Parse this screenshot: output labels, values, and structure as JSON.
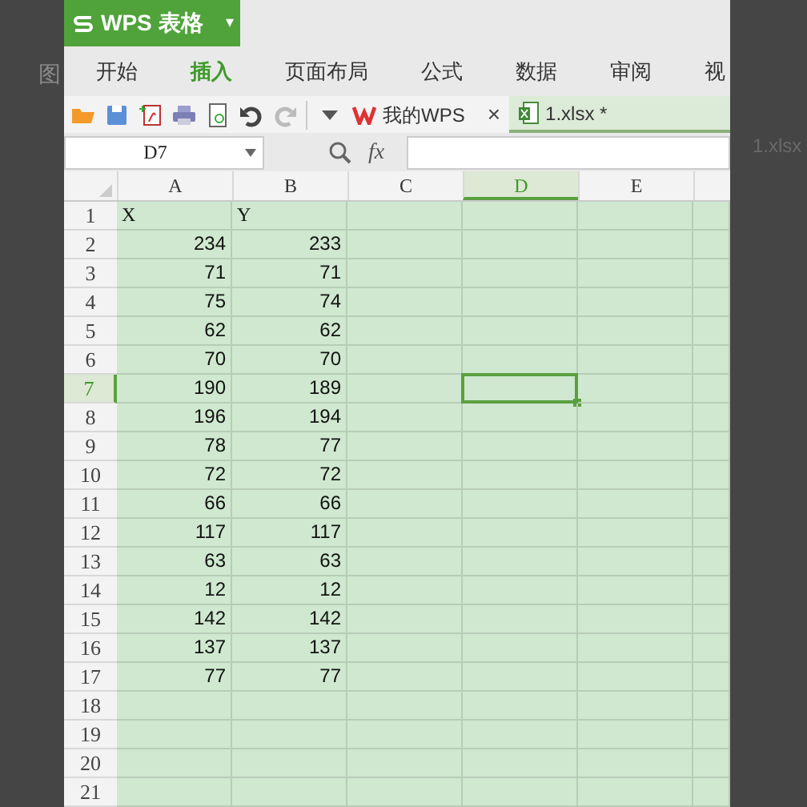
{
  "background": {
    "left_text": "图",
    "right_text": "1.xlsx"
  },
  "app": {
    "title": "WPS 表格",
    "menu_caret": "▾"
  },
  "menu": [
    {
      "label": "开始",
      "selected": false
    },
    {
      "label": "插入",
      "selected": true
    },
    {
      "label": "页面布局",
      "selected": false
    },
    {
      "label": "公式",
      "selected": false
    },
    {
      "label": "数据",
      "selected": false
    },
    {
      "label": "审阅",
      "selected": false
    },
    {
      "label": "视",
      "selected": false
    }
  ],
  "doc_tabs": [
    {
      "kind": "home",
      "label": "我的WPS",
      "close": "×",
      "selected": false
    },
    {
      "kind": "sheet",
      "label": "1.xlsx *",
      "selected": true
    }
  ],
  "formula_bar": {
    "name_box": "D7",
    "fx": "fx"
  },
  "columns": [
    {
      "label": "A",
      "selected": false
    },
    {
      "label": "B",
      "selected": false
    },
    {
      "label": "C",
      "selected": false
    },
    {
      "label": "D",
      "selected": true
    },
    {
      "label": "E",
      "selected": false
    },
    {
      "selected": false
    }
  ],
  "rows": [
    {
      "n": "1",
      "selected": false,
      "cells": [
        "X",
        "Y"
      ]
    },
    {
      "n": "2",
      "selected": false,
      "cells": [
        "234",
        "233"
      ]
    },
    {
      "n": "3",
      "selected": false,
      "cells": [
        "71",
        "71"
      ]
    },
    {
      "n": "4",
      "selected": false,
      "cells": [
        "75",
        "74"
      ]
    },
    {
      "n": "5",
      "selected": false,
      "cells": [
        "62",
        "62"
      ]
    },
    {
      "n": "6",
      "selected": false,
      "cells": [
        "70",
        "70"
      ]
    },
    {
      "n": "7",
      "selected": true,
      "cells": [
        "190",
        "189"
      ]
    },
    {
      "n": "8",
      "selected": false,
      "cells": [
        "196",
        "194"
      ]
    },
    {
      "n": "9",
      "selected": false,
      "cells": [
        "78",
        "77"
      ]
    },
    {
      "n": "10",
      "selected": false,
      "cells": [
        "72",
        "72"
      ]
    },
    {
      "n": "11",
      "selected": false,
      "cells": [
        "66",
        "66"
      ]
    },
    {
      "n": "12",
      "selected": false,
      "cells": [
        "117",
        "117"
      ]
    },
    {
      "n": "13",
      "selected": false,
      "cells": [
        "63",
        "63"
      ]
    },
    {
      "n": "14",
      "selected": false,
      "cells": [
        "12",
        "12"
      ]
    },
    {
      "n": "15",
      "selected": false,
      "cells": [
        "142",
        "142"
      ]
    },
    {
      "n": "16",
      "selected": false,
      "cells": [
        "137",
        "137"
      ]
    },
    {
      "n": "17",
      "selected": false,
      "cells": [
        "77",
        "77"
      ]
    },
    {
      "n": "18",
      "selected": false,
      "cells": []
    },
    {
      "n": "19",
      "selected": false,
      "cells": []
    },
    {
      "n": "20",
      "selected": false,
      "cells": []
    },
    {
      "n": "21",
      "selected": false,
      "cells": []
    }
  ]
}
